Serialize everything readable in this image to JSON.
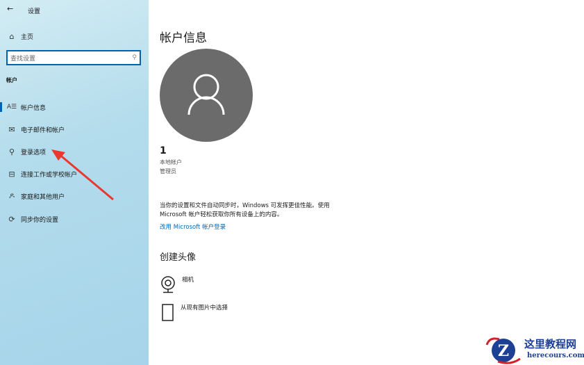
{
  "sidebar": {
    "back_icon": "arrow-left-icon",
    "title": "设置",
    "home": "主页",
    "search_placeholder": "查找设置",
    "section": "帐户",
    "items": [
      {
        "label": "帐户信息",
        "icon": "account-info-icon",
        "active": true
      },
      {
        "label": "电子邮件和帐户",
        "icon": "mail-icon"
      },
      {
        "label": "登录选项",
        "icon": "key-icon"
      },
      {
        "label": "连接工作或学校帐户",
        "icon": "briefcase-icon"
      },
      {
        "label": "家庭和其他用户",
        "icon": "person-icon"
      },
      {
        "label": "同步你的设置",
        "icon": "sync-icon"
      }
    ]
  },
  "main": {
    "title": "帐户信息",
    "user_name": "1",
    "account_type": "本地帐户",
    "role": "管理员",
    "description_line1": "当你的设置和文件自动同步时，Windows 可发挥更佳性能。使用",
    "description_line2": "Microsoft 帐户轻松获取你所有设备上的内容。",
    "ms_link": "改用 Microsoft 帐户登录",
    "create_avatar_title": "创建头像",
    "camera": "相机",
    "browse": "从现有图片中选择"
  },
  "watermark": {
    "name": "这里教程网",
    "url": "herecours.com"
  },
  "colors": {
    "accent": "#0063b1",
    "arrow": "#e8382f"
  }
}
